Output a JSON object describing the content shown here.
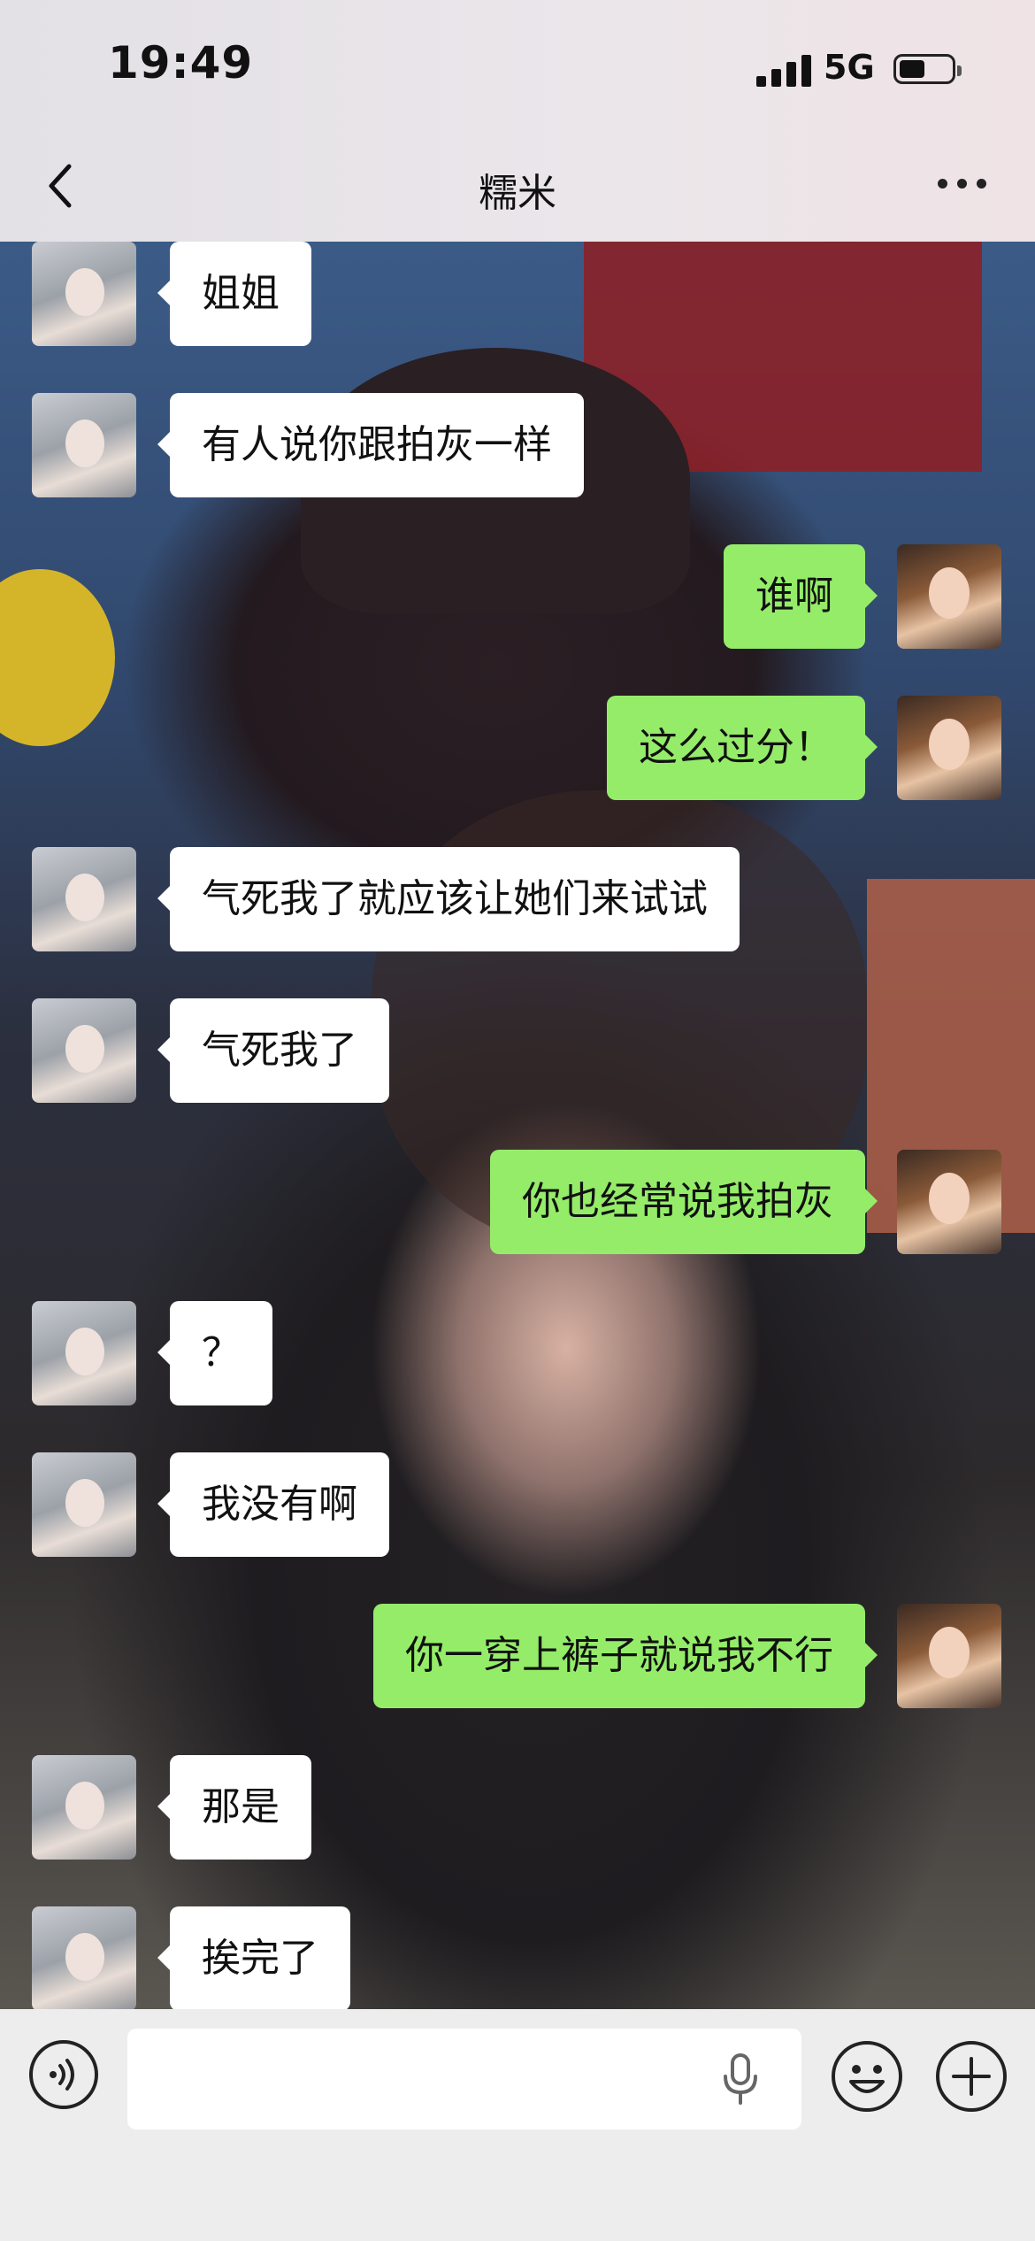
{
  "status_bar": {
    "time": "19:49",
    "network": "5G",
    "icons": [
      "signal-icon",
      "battery-icon"
    ]
  },
  "nav": {
    "title": "糯米",
    "icons": [
      "back-icon",
      "more-icon"
    ]
  },
  "messages": [
    {
      "side": "other",
      "text": "姐姐"
    },
    {
      "side": "other",
      "text": "有人说你跟拍灰一样"
    },
    {
      "side": "me",
      "text": "谁啊"
    },
    {
      "side": "me",
      "text": "这么过分！"
    },
    {
      "side": "other",
      "text": "气死我了就应该让她们来试试"
    },
    {
      "side": "other",
      "text": "气死我了"
    },
    {
      "side": "me",
      "text": "你也经常说我拍灰"
    },
    {
      "side": "other",
      "text": "？"
    },
    {
      "side": "other",
      "text": "我没有啊"
    },
    {
      "side": "me",
      "text": "你一穿上裤子就说我不行"
    },
    {
      "side": "other",
      "text": "那是"
    },
    {
      "side": "other",
      "text": "挨完了"
    }
  ],
  "input_bar": {
    "icons": [
      "voice-icon",
      "microphone-icon",
      "emoji-icon",
      "plus-icon"
    ],
    "text_value": ""
  },
  "colors": {
    "my_bubble": "#95ec69",
    "other_bubble": "#ffffff",
    "bar_background": "#ededed"
  }
}
